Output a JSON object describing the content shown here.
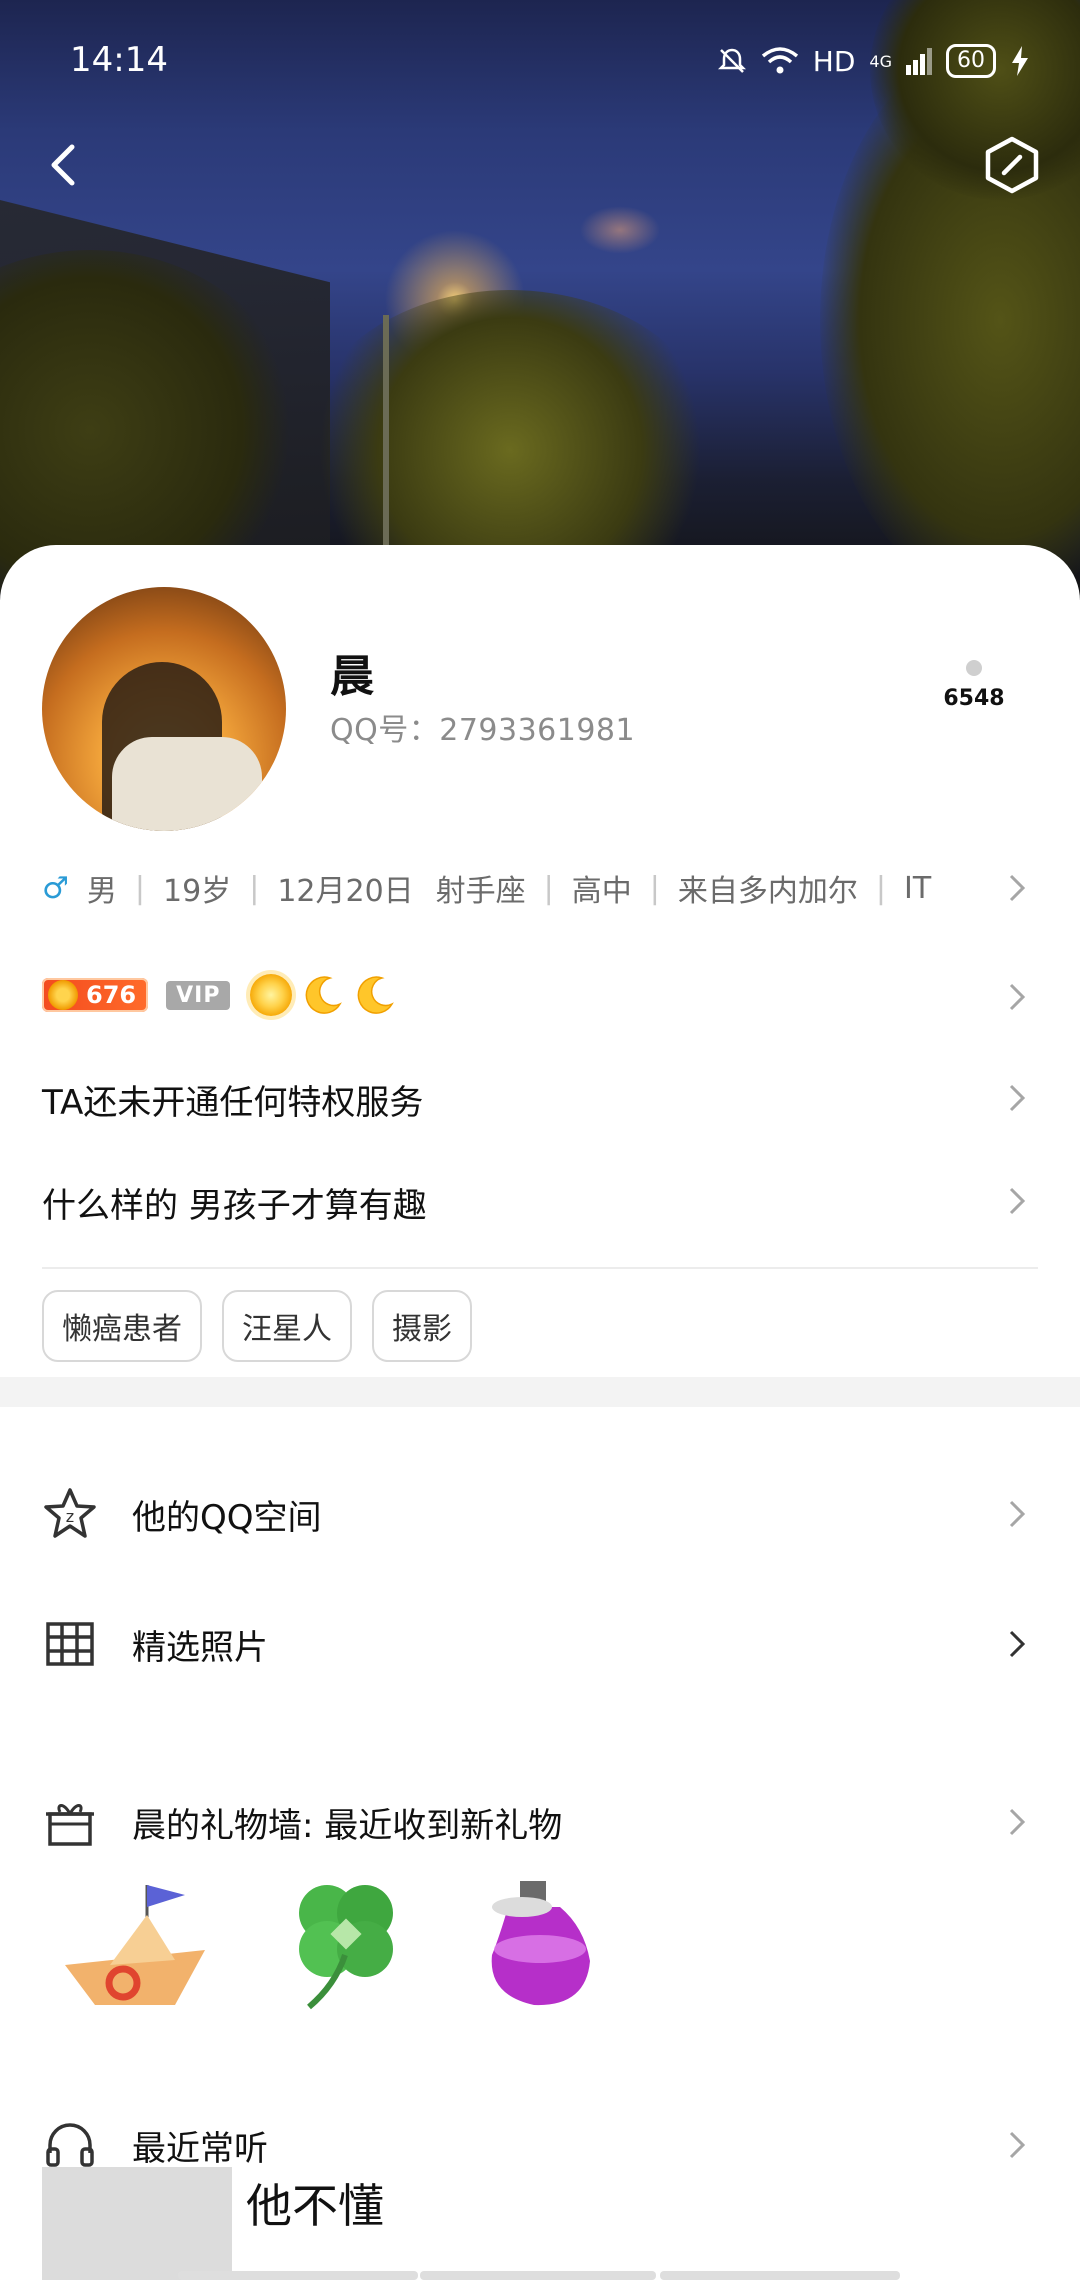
{
  "status_bar": {
    "time": "14:14",
    "network": "HD",
    "signal_type": "4G",
    "battery": "60"
  },
  "profile": {
    "name": "晨",
    "qq_label": "QQ号：2793361981",
    "like_count": "6548"
  },
  "info": {
    "gender_symbol": "♂",
    "gender": "男",
    "age": "19岁",
    "birthday": "12月20日",
    "zodiac": "射手座",
    "education": "高中",
    "location": "来自多内加尔",
    "job": "IT"
  },
  "badges": {
    "level": "676",
    "vip": "VIP"
  },
  "privilege_text": "TA还未开通任何特权服务",
  "signature": "什么样的 男孩子才算有趣",
  "tags": [
    "懒癌患者",
    "汪星人",
    "摄影"
  ],
  "menu": {
    "qzone": "他的QQ空间",
    "photos": "精选照片",
    "gift_wall": "晨的礼物墙: 最近收到新礼物",
    "music": "最近常听"
  },
  "music": {
    "song_title": "他不懂"
  },
  "colors": {
    "accent_blue": "#2a9bd6",
    "level_orange": "#f34b1f",
    "divider": "#ececec"
  }
}
